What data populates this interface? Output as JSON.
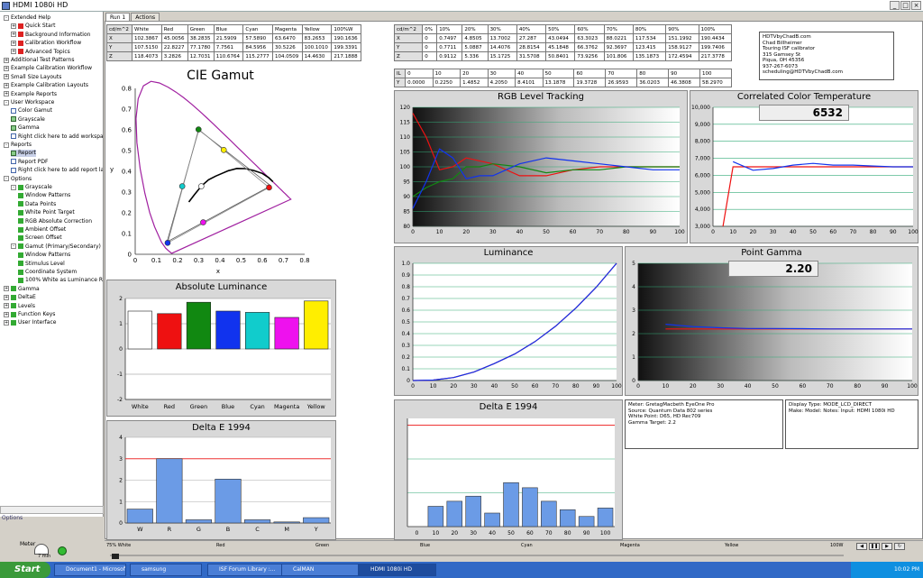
{
  "window": {
    "title": "HDMI 1080i HD"
  },
  "sidebar": {
    "items": [
      {
        "label": "Extended Help",
        "level": 0,
        "exp": "-",
        "icon": ""
      },
      {
        "label": "Quick Start",
        "level": 1,
        "exp": "+",
        "icon": "red"
      },
      {
        "label": "Background Information",
        "level": 1,
        "exp": "+",
        "icon": "red"
      },
      {
        "label": "Calibration Workflow",
        "level": 1,
        "exp": "+",
        "icon": "red"
      },
      {
        "label": "Advanced Topics",
        "level": 1,
        "exp": "+",
        "icon": "red"
      },
      {
        "label": "Additional Test Patterns",
        "level": 0,
        "exp": "+",
        "icon": ""
      },
      {
        "label": "Example Calibration Workflow",
        "level": 0,
        "exp": "+",
        "icon": ""
      },
      {
        "label": "Small Size Layouts",
        "level": 0,
        "exp": "+",
        "icon": ""
      },
      {
        "label": "Example Calibration Layouts",
        "level": 0,
        "exp": "+",
        "icon": ""
      },
      {
        "label": "Example Reports",
        "level": 0,
        "exp": "+",
        "icon": ""
      },
      {
        "label": "User Workspace",
        "level": 0,
        "exp": "-",
        "icon": ""
      },
      {
        "label": "Color Gamut",
        "level": 1,
        "exp": "",
        "icon": "doc"
      },
      {
        "label": "Grayscale",
        "level": 1,
        "exp": "",
        "icon": "chart"
      },
      {
        "label": "Gamma",
        "level": 1,
        "exp": "",
        "icon": "chart"
      },
      {
        "label": "Right click here to add workspa",
        "level": 1,
        "exp": "",
        "icon": "doc"
      },
      {
        "label": "Reports",
        "level": 0,
        "exp": "-",
        "icon": ""
      },
      {
        "label": "Report",
        "level": 1,
        "exp": "",
        "icon": "chart",
        "sel": true
      },
      {
        "label": "Report PDF",
        "level": 1,
        "exp": "",
        "icon": "doc"
      },
      {
        "label": "Right click here to add report lay",
        "level": 1,
        "exp": "",
        "icon": "doc"
      },
      {
        "label": "Options",
        "level": 0,
        "exp": "-",
        "icon": ""
      },
      {
        "label": "Grayscale",
        "level": 1,
        "exp": "-",
        "icon": "grn"
      },
      {
        "label": "Window Patterns",
        "level": 2,
        "exp": "",
        "icon": "grn"
      },
      {
        "label": "Data Points",
        "level": 2,
        "exp": "",
        "icon": "grn"
      },
      {
        "label": "White Point Target",
        "level": 2,
        "exp": "",
        "icon": "grn"
      },
      {
        "label": "RGB Absolute Correction",
        "level": 2,
        "exp": "",
        "icon": "grn"
      },
      {
        "label": "Ambient Offset",
        "level": 2,
        "exp": "",
        "icon": "grn"
      },
      {
        "label": "Screen Offset",
        "level": 2,
        "exp": "",
        "icon": "grn"
      },
      {
        "label": "Gamut (Primary/Secondary)",
        "level": 1,
        "exp": "-",
        "icon": "grn"
      },
      {
        "label": "Window Patterns",
        "level": 2,
        "exp": "",
        "icon": "grn"
      },
      {
        "label": "Stimulus Level",
        "level": 2,
        "exp": "",
        "icon": "grn"
      },
      {
        "label": "Coordinate System",
        "level": 2,
        "exp": "",
        "icon": "grn"
      },
      {
        "label": "100% White as Luminance R",
        "level": 2,
        "exp": "",
        "icon": "grn"
      },
      {
        "label": "Gamma",
        "level": 0,
        "exp": "+",
        "icon": "grn"
      },
      {
        "label": "DeltaE",
        "level": 0,
        "exp": "+",
        "icon": "grn"
      },
      {
        "label": "Levels",
        "level": 0,
        "exp": "+",
        "icon": "grn"
      },
      {
        "label": "Function Keys",
        "level": 0,
        "exp": "+",
        "icon": "grn"
      },
      {
        "label": "User Interface",
        "level": 0,
        "exp": "+",
        "icon": "grn"
      }
    ],
    "options_label": "Options",
    "meter_label": "Meter",
    "meter_value": "7 min"
  },
  "tabs": [
    "Run 1",
    "Actions"
  ],
  "gamut_table": {
    "header": [
      "cd/m^2",
      "White",
      "Red",
      "Green",
      "Blue",
      "Cyan",
      "Magenta",
      "Yellow",
      "100%W"
    ],
    "rows": [
      [
        "X",
        "102.3867",
        "45.0056",
        "38.2835",
        "21.5909",
        "57.5890",
        "63.6470",
        "83.2653",
        "190.1636"
      ],
      [
        "Y",
        "107.5150",
        "22.8227",
        "77.1780",
        "7.7561",
        "84.5956",
        "30.5226",
        "100.1010",
        "199.3391"
      ],
      [
        "Z",
        "118.4073",
        "3.2826",
        "12.7031",
        "110.6764",
        "115.2777",
        "104.0509",
        "14.4630",
        "217.1888"
      ]
    ]
  },
  "gray_table": {
    "header": [
      "cd/m^2",
      "0%",
      "10%",
      "20%",
      "30%",
      "40%",
      "50%",
      "60%",
      "70%",
      "80%",
      "90%",
      "100%"
    ],
    "rows": [
      [
        "X",
        "0",
        "0.7497",
        "4.8505",
        "13.7002",
        "27.287",
        "43.0494",
        "63.3023",
        "88.0221",
        "117.534",
        "151.1992",
        "190.4434"
      ],
      [
        "Y",
        "0",
        "0.7711",
        "5.0887",
        "14.4076",
        "28.8154",
        "45.1848",
        "66.3762",
        "92.3697",
        "123.415",
        "158.9127",
        "199.7406"
      ],
      [
        "Z",
        "0",
        "0.9112",
        "5.336",
        "15.1725",
        "31.5708",
        "50.8401",
        "73.9256",
        "101.806",
        "135.1873",
        "172.4594",
        "217.3778"
      ]
    ]
  },
  "ire_table": {
    "header": [
      "IL",
      "0",
      "10",
      "20",
      "30",
      "40",
      "50",
      "60",
      "70",
      "80",
      "90",
      "100"
    ],
    "rows": [
      [
        "Y",
        "0.0000",
        "0.2250",
        "1.4852",
        "4.2050",
        "8.4101",
        "13.1878",
        "19.3728",
        "26.9593",
        "36.0203",
        "46.3808",
        "58.2970"
      ]
    ]
  },
  "contact": {
    "lines": [
      "HDTVbyChadB.com",
      "Chad Billheimer",
      "Touring ISF calibrator",
      "315 Gamsey St",
      "Piqua, OH 45356",
      "937-267-6073",
      "scheduling@HDTVbyChadB.com"
    ]
  },
  "meter_info": {
    "lines": [
      "Meter: GretagMacbeth EyeOne Pro",
      "Source: Quantum Data 802 series",
      "White Point: D65, HD Rec709",
      "Gamma Target: 2.2"
    ]
  },
  "display_info": {
    "lines": [
      "Display Type: MODE_LCD_DIRECT",
      "Make: Model: Notes: Input: HDMI 1080i HD"
    ]
  },
  "readouts": {
    "cct": "6532",
    "gamma": "2.20"
  },
  "bottom_bar": {
    "labels": [
      "75% White",
      "Red",
      "Green",
      "Blue",
      "Cyan",
      "Magenta",
      "Yellow",
      "100W"
    ]
  },
  "taskbar": {
    "start": "Start",
    "buttons": [
      "Document1 - Microsof...",
      "samsung",
      "ISF Forum Library :...",
      "CalMAN",
      "HDMI 1080i HD"
    ],
    "clock": "10:02 PM"
  },
  "colors": {
    "red": "#ee1111",
    "green": "#118811",
    "blue": "#1133ee",
    "cyan": "#11cccc",
    "magenta": "#ee11ee",
    "yellow": "#ffee00",
    "white": "#ffffff"
  },
  "chart_data": [
    {
      "type": "scatter",
      "title": "CIE Gamut",
      "xlabel": "x",
      "ylabel": "y",
      "xlim": [
        0,
        0.8
      ],
      "ylim": [
        0,
        0.8
      ],
      "xticks": [
        "0",
        "0.1",
        "0.2",
        "0.3",
        "0.4",
        "0.5",
        "0.6",
        "0.7",
        "0.8"
      ],
      "yticks": [
        "0",
        "0.1",
        "0.2",
        "0.3",
        "0.4",
        "0.5",
        "0.6",
        "0.7",
        "0.8"
      ],
      "target_points": [
        {
          "name": "Red",
          "x": 0.64,
          "y": 0.33
        },
        {
          "name": "Green",
          "x": 0.3,
          "y": 0.6
        },
        {
          "name": "Blue",
          "x": 0.15,
          "y": 0.06
        },
        {
          "name": "Cyan",
          "x": 0.225,
          "y": 0.329
        },
        {
          "name": "Magenta",
          "x": 0.321,
          "y": 0.154
        },
        {
          "name": "Yellow",
          "x": 0.419,
          "y": 0.505
        },
        {
          "name": "White",
          "x": 0.3127,
          "y": 0.329
        }
      ],
      "measured_points": [
        {
          "name": "Red",
          "x": 0.632,
          "y": 0.322,
          "color": "#ee1111"
        },
        {
          "name": "Green",
          "x": 0.299,
          "y": 0.602,
          "color": "#118811"
        },
        {
          "name": "Blue",
          "x": 0.153,
          "y": 0.055,
          "color": "#1133ee"
        },
        {
          "name": "Cyan",
          "x": 0.222,
          "y": 0.328,
          "color": "#11cccc"
        },
        {
          "name": "Magenta",
          "x": 0.321,
          "y": 0.154,
          "color": "#ee11ee"
        },
        {
          "name": "Yellow",
          "x": 0.418,
          "y": 0.503,
          "color": "#ffee00"
        },
        {
          "name": "White",
          "x": 0.312,
          "y": 0.328,
          "color": "#ffffff"
        }
      ]
    },
    {
      "type": "bar",
      "title": "Absolute Luminance",
      "categories": [
        "White",
        "Red",
        "Green",
        "Blue",
        "Cyan",
        "Magenta",
        "Yellow"
      ],
      "values": [
        1.5,
        1.4,
        1.85,
        1.5,
        1.45,
        1.25,
        1.9
      ],
      "colors": [
        "#ffffff",
        "#ee1111",
        "#118811",
        "#1133ee",
        "#11cccc",
        "#ee11ee",
        "#ffee00"
      ],
      "ylim": [
        -2,
        2
      ],
      "yticks": [
        "2",
        "1",
        "0",
        "-1",
        "-2"
      ]
    },
    {
      "type": "bar",
      "title": "Delta E 1994",
      "categories": [
        "W",
        "R",
        "G",
        "B",
        "C",
        "M",
        "Y"
      ],
      "values": [
        0.65,
        3.0,
        0.15,
        2.05,
        0.15,
        0.05,
        0.25
      ],
      "ylim": [
        0,
        4
      ],
      "yticks": [
        "0",
        "1",
        "2",
        "3",
        "4"
      ],
      "threshold": 3
    },
    {
      "type": "line",
      "title": "RGB Level Tracking",
      "x": [
        0,
        5,
        10,
        15,
        20,
        25,
        30,
        40,
        50,
        60,
        70,
        80,
        90,
        100
      ],
      "xlim": [
        0,
        100
      ],
      "ylim": [
        80,
        120
      ],
      "xticks": [
        "0",
        "10",
        "20",
        "30",
        "40",
        "50",
        "60",
        "70",
        "80",
        "90",
        "100"
      ],
      "yticks": [
        "80",
        "85",
        "90",
        "95",
        "100",
        "105",
        "110",
        "115",
        "120"
      ],
      "series": [
        {
          "color": "#ee1111",
          "values": [
            118,
            110,
            99,
            100,
            103,
            102,
            101,
            97,
            97,
            99,
            100,
            100,
            100,
            100
          ]
        },
        {
          "color": "#118811",
          "values": [
            90,
            93,
            95,
            96,
            100,
            100,
            101,
            100,
            98,
            99,
            99,
            100,
            100,
            100
          ]
        },
        {
          "color": "#1133ee",
          "values": [
            86,
            95,
            106,
            103,
            96,
            97,
            97,
            101,
            103,
            102,
            101,
            100,
            99,
            99
          ]
        }
      ]
    },
    {
      "type": "line",
      "title": "Correlated Color Temperature",
      "x": [
        0,
        5,
        10,
        20,
        30,
        40,
        50,
        60,
        70,
        80,
        90,
        100
      ],
      "xlim": [
        0,
        100
      ],
      "ylim": [
        3000,
        10000
      ],
      "xticks": [
        "0",
        "10",
        "20",
        "30",
        "40",
        "50",
        "60",
        "70",
        "80",
        "90",
        "100"
      ],
      "yticks": [
        "3,000",
        "4,000",
        "5,000",
        "6,000",
        "7,000",
        "8,000",
        "9,000",
        "10,000"
      ],
      "series": [
        {
          "color": "#ee1111",
          "values": [
            null,
            3000,
            6500,
            6500,
            6500,
            6500,
            6500,
            6500,
            6500,
            6500,
            6500,
            6500
          ]
        },
        {
          "color": "#1133ee",
          "values": [
            5400,
            null,
            6800,
            6300,
            6400,
            6600,
            6700,
            6600,
            6600,
            6550,
            6500,
            6500
          ]
        }
      ]
    },
    {
      "type": "line",
      "title": "Luminance",
      "x": [
        0,
        10,
        20,
        30,
        40,
        50,
        60,
        70,
        80,
        90,
        100
      ],
      "xlim": [
        0,
        100
      ],
      "ylim": [
        0,
        1
      ],
      "xticks": [
        "0",
        "10",
        "20",
        "30",
        "40",
        "50",
        "60",
        "70",
        "80",
        "90",
        "100"
      ],
      "yticks": [
        "0",
        "0.1",
        "0.2",
        "0.3",
        "0.4",
        "0.5",
        "0.6",
        "0.7",
        "0.8",
        "0.9",
        "1.0"
      ],
      "series": [
        {
          "color": "#ee1111",
          "values": [
            0,
            0.0039,
            0.0255,
            0.0721,
            0.1443,
            0.2262,
            0.3323,
            0.4624,
            0.6179,
            0.7956,
            1.0
          ]
        },
        {
          "color": "#1133ee",
          "values": [
            0,
            0.0039,
            0.0255,
            0.0721,
            0.1443,
            0.2262,
            0.3323,
            0.4624,
            0.6179,
            0.7956,
            1.0
          ]
        }
      ]
    },
    {
      "type": "line",
      "title": "Point Gamma",
      "x": [
        0,
        10,
        20,
        30,
        40,
        50,
        60,
        70,
        80,
        90,
        100
      ],
      "xlim": [
        0,
        100
      ],
      "ylim": [
        0,
        5
      ],
      "xticks": [
        "0",
        "10",
        "20",
        "30",
        "40",
        "50",
        "60",
        "70",
        "80",
        "90",
        "100"
      ],
      "yticks": [
        "0",
        "1",
        "2",
        "3",
        "4",
        "5"
      ],
      "series": [
        {
          "color": "#ee1111",
          "values": [
            null,
            2.2,
            2.2,
            2.2,
            2.2,
            2.2,
            2.2,
            2.2,
            2.2,
            2.2,
            2.2
          ]
        },
        {
          "color": "#1133ee",
          "values": [
            null,
            2.4,
            2.3,
            2.25,
            2.22,
            2.22,
            2.21,
            2.2,
            2.2,
            2.2,
            2.2
          ]
        }
      ]
    },
    {
      "type": "bar",
      "title": "Delta E 1994",
      "categories": [
        "0",
        "10",
        "20",
        "30",
        "40",
        "50",
        "60",
        "70",
        "80",
        "90",
        "100"
      ],
      "values": [
        0,
        0.6,
        0.75,
        0.9,
        0.4,
        1.3,
        1.15,
        0.75,
        0.5,
        0.3,
        0.55
      ],
      "ylim": [
        0,
        3.2
      ],
      "xticks": [
        "0",
        "10",
        "20",
        "30",
        "40",
        "50",
        "60",
        "70",
        "80",
        "90",
        "100"
      ],
      "threshold": 3
    }
  ]
}
